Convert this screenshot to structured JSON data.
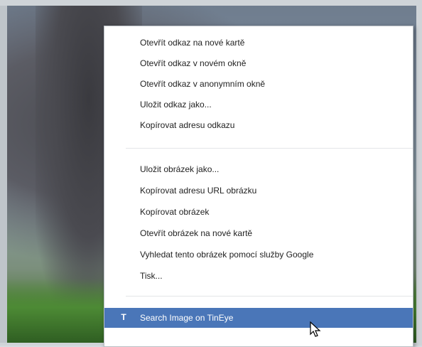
{
  "menu": {
    "group1": [
      "Otevřít odkaz na nové kartě",
      "Otevřít odkaz v novém okně",
      "Otevřít odkaz v anonymním okně",
      "Uložit odkaz jako...",
      "Kopírovat adresu odkazu"
    ],
    "group2": [
      "Uložit obrázek jako...",
      "Kopírovat adresu URL obrázku",
      "Kopírovat obrázek",
      "Otevřít obrázek na nové kartě",
      "Vyhledat tento obrázek pomocí služby Google",
      "Tisk..."
    ],
    "extension_item": {
      "label": "Search Image on TinEye",
      "icon": "T",
      "icon_name": "tineye-icon",
      "highlight_color": "#4a76b8"
    }
  }
}
